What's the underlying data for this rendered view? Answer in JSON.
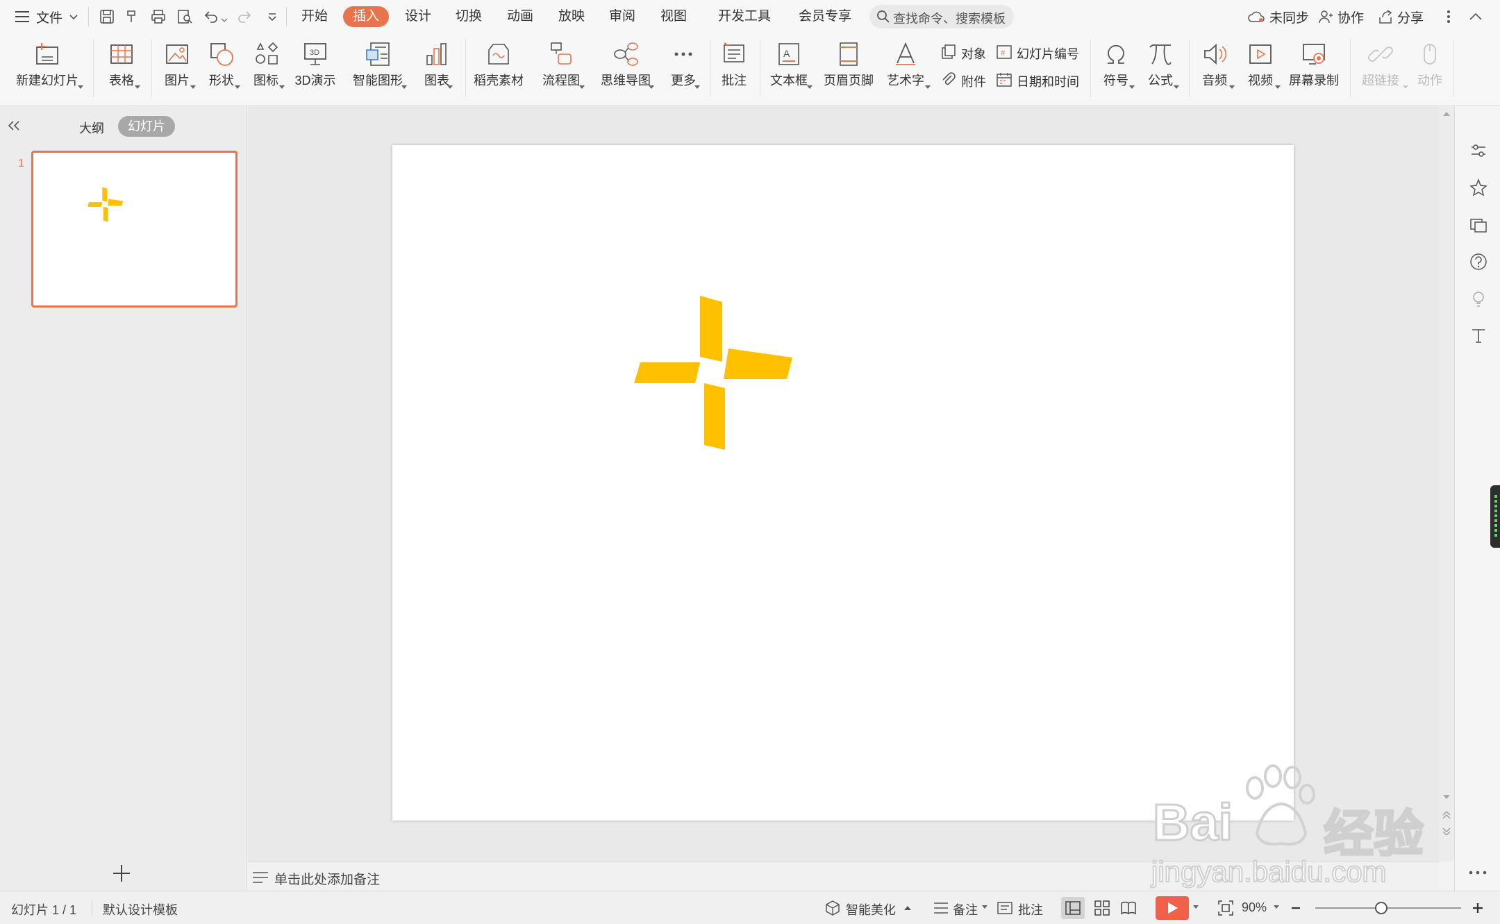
{
  "menu": {
    "file_label": "文件",
    "tabs": [
      {
        "label": "开始",
        "active": false
      },
      {
        "label": "插入",
        "active": true
      },
      {
        "label": "设计",
        "active": false
      },
      {
        "label": "切换",
        "active": false
      },
      {
        "label": "动画",
        "active": false
      },
      {
        "label": "放映",
        "active": false
      },
      {
        "label": "审阅",
        "active": false
      },
      {
        "label": "视图",
        "active": false
      },
      {
        "label": "开发工具",
        "active": false
      },
      {
        "label": "会员专享",
        "active": false
      }
    ],
    "search_placeholder": "查找命令、搜索模板",
    "sync_label": "未同步",
    "collab_label": "协作",
    "share_label": "分享"
  },
  "ribbon": {
    "new_slide": "新建幻灯片",
    "table": "表格",
    "picture": "图片",
    "shape": "形状",
    "icon": "图标",
    "demo3d": "3D演示",
    "smartart": "智能图形",
    "chart": "图表",
    "docer": "稻壳素材",
    "flowchart": "流程图",
    "mindmap": "思维导图",
    "more": "更多",
    "comment": "批注",
    "textbox": "文本框",
    "header_footer": "页眉页脚",
    "wordart": "艺术字",
    "object": "对象",
    "slide_number": "幻灯片编号",
    "attachment": "附件",
    "date_time": "日期和时间",
    "symbol": "符号",
    "formula": "公式",
    "audio": "音频",
    "video": "视频",
    "screen_record": "屏幕录制",
    "hyperlink": "超链接",
    "action": "动作"
  },
  "left_panel": {
    "tab_outline": "大纲",
    "tab_slides": "幻灯片",
    "slide_number": "1",
    "add_slide_label": "+"
  },
  "notes": {
    "placeholder": "单击此处添加备注"
  },
  "status": {
    "slide_info": "幻灯片 1 / 1",
    "template": "默认设计模板",
    "beautify": "智能美化",
    "notes": "备注",
    "comments": "批注",
    "zoom": "90%",
    "zoom_level": 0.45
  },
  "slide": {
    "shape_color": "#ffc000"
  },
  "colors": {
    "accent": "#e8744c",
    "play": "#f0614b"
  },
  "watermark": {
    "brand": "Bai",
    "brand2": "经验",
    "url": "jingyan.baidu.com"
  }
}
